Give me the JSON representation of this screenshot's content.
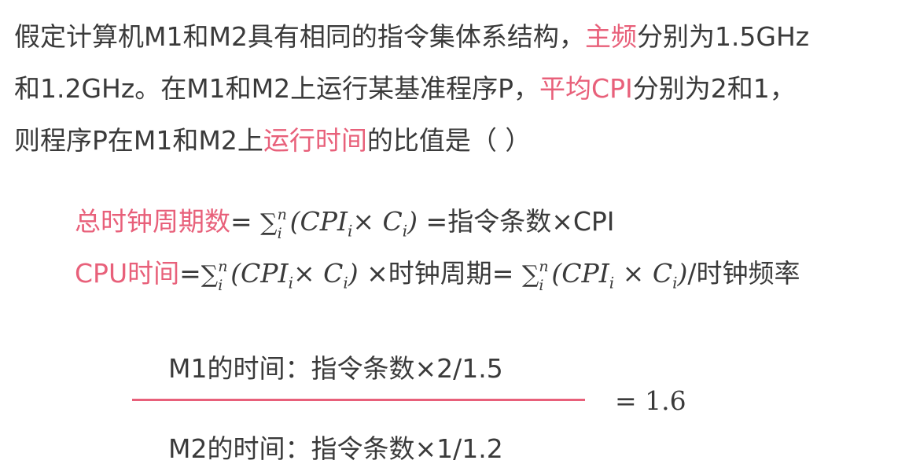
{
  "question": {
    "line1": {
      "pre": "假定计算机M1和M2具有相同的指令集体系结构，",
      "hl": "主频",
      "post": "分别为1.5GHz"
    },
    "line2": {
      "pre": "和1.2GHz。在M1和M2上运行某基准程序P，",
      "hl": "平均CPI",
      "post": "分别为2和1，"
    },
    "line3": {
      "pre": "则程序P在M1和M2上",
      "hl": "运行时间",
      "post": "的比值是（ ）"
    }
  },
  "formula1": {
    "label": "总时钟周期数",
    "eq": "=",
    "sum": "∑",
    "upper": "n",
    "lower": "i",
    "open": "(CPI",
    "sub_i": "i",
    "times": "×",
    "c": "C",
    "sub_i2": "i",
    "close": ")",
    "rhs": "=指令条数×CPI"
  },
  "formula2": {
    "label": "CPU时间",
    "eq": "=",
    "sum": "∑",
    "upper": "n",
    "lower": "i",
    "open": "(CPI",
    "sub_i": "i",
    "times": "×",
    "c": "C",
    "sub_i2": "i",
    "close": ")",
    "mid": "×时钟周期=",
    "sum2": "∑",
    "upper2": "n",
    "lower2": "i",
    "open2": "(CPI",
    "sub_i3": "i",
    "times2": "×",
    "c2": "C",
    "sub_i4": "i",
    "close2": ")",
    "rhs": "/时钟频率"
  },
  "fraction": {
    "numerator": "M1的时间：指令条数×2/1.5",
    "denominator": "M2的时间：指令条数×1/1.2",
    "result": "= 1.6"
  },
  "colors": {
    "highlight": "#e8607a",
    "text": "#3a3a3a"
  }
}
